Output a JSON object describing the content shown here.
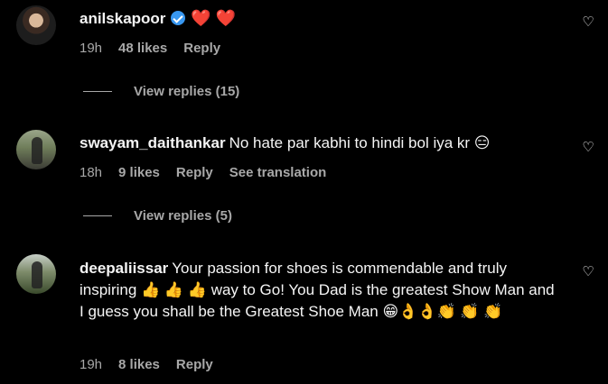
{
  "comments": [
    {
      "username": "anilskapoor",
      "text": "",
      "hearts": "❤️ ❤️",
      "time": "19h",
      "likes": "48 likes",
      "reply": "Reply",
      "view_replies": "View replies (15)"
    },
    {
      "username": "swayam_daithankar",
      "text": "No hate par kabhi to hindi bol iya kr 😑",
      "time": "18h",
      "likes": "9 likes",
      "reply": "Reply",
      "translation": "See translation",
      "view_replies": "View replies (5)"
    },
    {
      "username": "deepaliissar",
      "text": "Your passion for shoes is commendable and truly inspiring 👍 👍 👍 way to Go! You Dad is the greatest Show Man and I guess you shall be the Greatest Shoe Man 😁👌👌👏 👏 👏",
      "time": "19h",
      "likes": "8 likes",
      "reply": "Reply"
    }
  ],
  "icons": {
    "like": "heart-outline-icon",
    "verified": "verified-badge-icon"
  }
}
